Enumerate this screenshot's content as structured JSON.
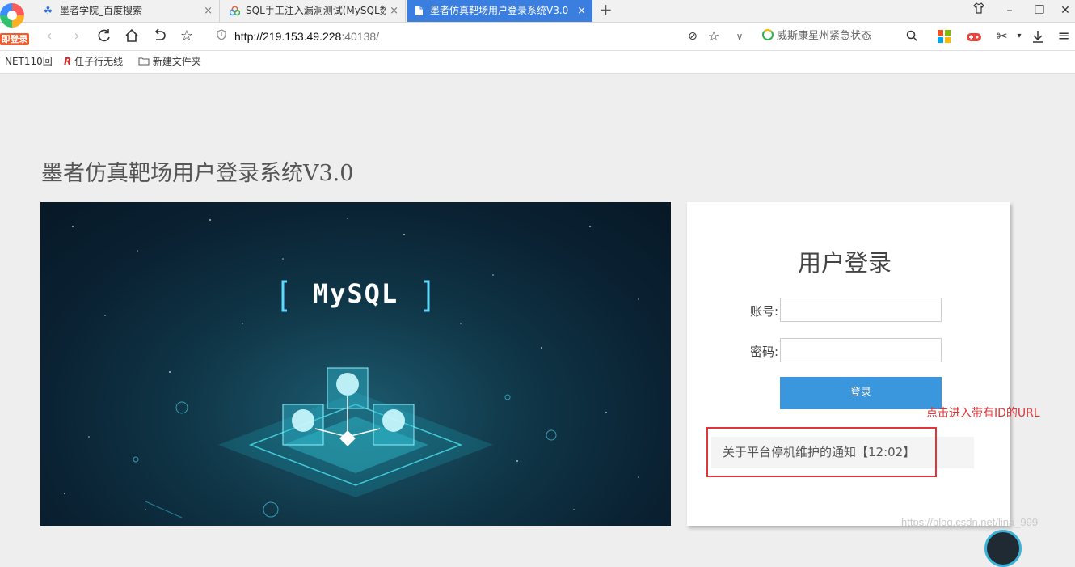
{
  "browser": {
    "login_badge": "即登录",
    "tabs": [
      {
        "title": "墨者学院_百度搜索",
        "icon": "baidu-paw-icon"
      },
      {
        "title": "SQL手工注入漏洞测试(MySQL数据库)",
        "icon": "cloud-icon"
      },
      {
        "title": "墨者仿真靶场用户登录系统V3.0",
        "icon": "document-icon",
        "active": true
      }
    ],
    "new_tab": "+",
    "address": {
      "host": "http://219.153.49.228",
      "rest": ":40138/"
    },
    "news_text": "威斯康星州紧急状态",
    "bookmarks": [
      {
        "label": "NET110回"
      },
      {
        "label": "任子行无线"
      },
      {
        "label": "新建文件夹"
      }
    ]
  },
  "page": {
    "title": "墨者仿真靶场用户登录系统V3.0",
    "banner_text": "MySQL",
    "login": {
      "heading": "用户登录",
      "account_label": "账号:",
      "password_label": "密码:",
      "account_value": "",
      "password_value": "",
      "submit": "登录"
    },
    "notice": "关于平台停机维护的通知【12:02】"
  },
  "annotation": {
    "text": "点击进入带有ID的URL",
    "color": "#e0363a"
  },
  "watermark": "https://blog.csdn.net/lina_999"
}
